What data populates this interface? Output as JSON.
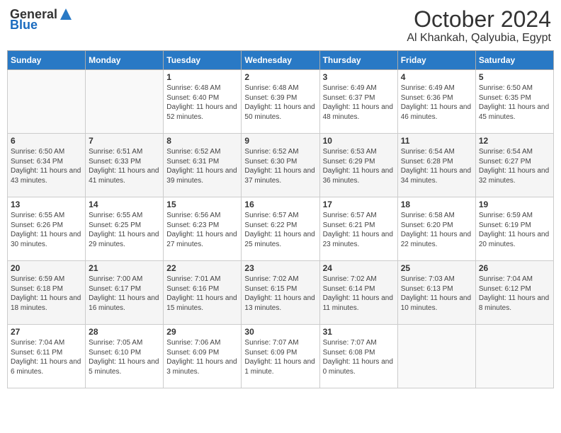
{
  "header": {
    "logo_general": "General",
    "logo_blue": "Blue",
    "month": "October 2024",
    "location": "Al Khankah, Qalyubia, Egypt"
  },
  "days_of_week": [
    "Sunday",
    "Monday",
    "Tuesday",
    "Wednesday",
    "Thursday",
    "Friday",
    "Saturday"
  ],
  "weeks": [
    [
      {
        "day": "",
        "empty": true
      },
      {
        "day": "",
        "empty": true
      },
      {
        "day": "1",
        "sunrise": "6:48 AM",
        "sunset": "6:40 PM",
        "daylight": "11 hours and 52 minutes."
      },
      {
        "day": "2",
        "sunrise": "6:48 AM",
        "sunset": "6:39 PM",
        "daylight": "11 hours and 50 minutes."
      },
      {
        "day": "3",
        "sunrise": "6:49 AM",
        "sunset": "6:37 PM",
        "daylight": "11 hours and 48 minutes."
      },
      {
        "day": "4",
        "sunrise": "6:49 AM",
        "sunset": "6:36 PM",
        "daylight": "11 hours and 46 minutes."
      },
      {
        "day": "5",
        "sunrise": "6:50 AM",
        "sunset": "6:35 PM",
        "daylight": "11 hours and 45 minutes."
      }
    ],
    [
      {
        "day": "6",
        "sunrise": "6:50 AM",
        "sunset": "6:34 PM",
        "daylight": "11 hours and 43 minutes."
      },
      {
        "day": "7",
        "sunrise": "6:51 AM",
        "sunset": "6:33 PM",
        "daylight": "11 hours and 41 minutes."
      },
      {
        "day": "8",
        "sunrise": "6:52 AM",
        "sunset": "6:31 PM",
        "daylight": "11 hours and 39 minutes."
      },
      {
        "day": "9",
        "sunrise": "6:52 AM",
        "sunset": "6:30 PM",
        "daylight": "11 hours and 37 minutes."
      },
      {
        "day": "10",
        "sunrise": "6:53 AM",
        "sunset": "6:29 PM",
        "daylight": "11 hours and 36 minutes."
      },
      {
        "day": "11",
        "sunrise": "6:54 AM",
        "sunset": "6:28 PM",
        "daylight": "11 hours and 34 minutes."
      },
      {
        "day": "12",
        "sunrise": "6:54 AM",
        "sunset": "6:27 PM",
        "daylight": "11 hours and 32 minutes."
      }
    ],
    [
      {
        "day": "13",
        "sunrise": "6:55 AM",
        "sunset": "6:26 PM",
        "daylight": "11 hours and 30 minutes."
      },
      {
        "day": "14",
        "sunrise": "6:55 AM",
        "sunset": "6:25 PM",
        "daylight": "11 hours and 29 minutes."
      },
      {
        "day": "15",
        "sunrise": "6:56 AM",
        "sunset": "6:23 PM",
        "daylight": "11 hours and 27 minutes."
      },
      {
        "day": "16",
        "sunrise": "6:57 AM",
        "sunset": "6:22 PM",
        "daylight": "11 hours and 25 minutes."
      },
      {
        "day": "17",
        "sunrise": "6:57 AM",
        "sunset": "6:21 PM",
        "daylight": "11 hours and 23 minutes."
      },
      {
        "day": "18",
        "sunrise": "6:58 AM",
        "sunset": "6:20 PM",
        "daylight": "11 hours and 22 minutes."
      },
      {
        "day": "19",
        "sunrise": "6:59 AM",
        "sunset": "6:19 PM",
        "daylight": "11 hours and 20 minutes."
      }
    ],
    [
      {
        "day": "20",
        "sunrise": "6:59 AM",
        "sunset": "6:18 PM",
        "daylight": "11 hours and 18 minutes."
      },
      {
        "day": "21",
        "sunrise": "7:00 AM",
        "sunset": "6:17 PM",
        "daylight": "11 hours and 16 minutes."
      },
      {
        "day": "22",
        "sunrise": "7:01 AM",
        "sunset": "6:16 PM",
        "daylight": "11 hours and 15 minutes."
      },
      {
        "day": "23",
        "sunrise": "7:02 AM",
        "sunset": "6:15 PM",
        "daylight": "11 hours and 13 minutes."
      },
      {
        "day": "24",
        "sunrise": "7:02 AM",
        "sunset": "6:14 PM",
        "daylight": "11 hours and 11 minutes."
      },
      {
        "day": "25",
        "sunrise": "7:03 AM",
        "sunset": "6:13 PM",
        "daylight": "11 hours and 10 minutes."
      },
      {
        "day": "26",
        "sunrise": "7:04 AM",
        "sunset": "6:12 PM",
        "daylight": "11 hours and 8 minutes."
      }
    ],
    [
      {
        "day": "27",
        "sunrise": "7:04 AM",
        "sunset": "6:11 PM",
        "daylight": "11 hours and 6 minutes."
      },
      {
        "day": "28",
        "sunrise": "7:05 AM",
        "sunset": "6:10 PM",
        "daylight": "11 hours and 5 minutes."
      },
      {
        "day": "29",
        "sunrise": "7:06 AM",
        "sunset": "6:09 PM",
        "daylight": "11 hours and 3 minutes."
      },
      {
        "day": "30",
        "sunrise": "7:07 AM",
        "sunset": "6:09 PM",
        "daylight": "11 hours and 1 minute."
      },
      {
        "day": "31",
        "sunrise": "7:07 AM",
        "sunset": "6:08 PM",
        "daylight": "11 hours and 0 minutes."
      },
      {
        "day": "",
        "empty": true
      },
      {
        "day": "",
        "empty": true
      }
    ]
  ],
  "labels": {
    "sunrise": "Sunrise:",
    "sunset": "Sunset:",
    "daylight": "Daylight:"
  }
}
